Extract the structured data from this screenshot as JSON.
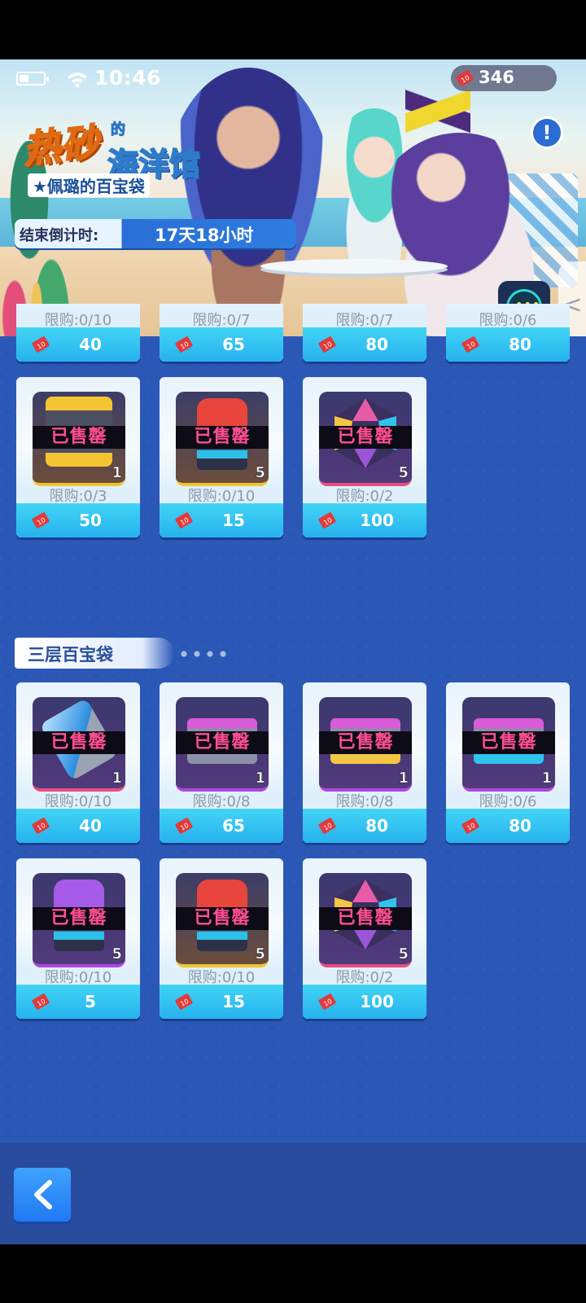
{
  "status_bar": {
    "time": "10:46",
    "currency_amount": "346"
  },
  "banner": {
    "title_main": "热砂",
    "title_de": "的",
    "title_sub": "海洋馆",
    "subtitle": "★佩璐的百宝袋",
    "countdown_label": "结束倒计时:",
    "countdown_value": "17天18小时",
    "info_icon": "exclamation-icon",
    "side_arrow": "<"
  },
  "section_two_partial": [
    {
      "limit": "限购:0/10",
      "price": "40"
    },
    {
      "limit": "限购:0/7",
      "price": "65"
    },
    {
      "limit": "限购:0/7",
      "price": "80"
    },
    {
      "limit": "限购:0/6",
      "price": "80"
    }
  ],
  "section_two_row2": [
    {
      "icon": "vehicle-icon",
      "sold": "已售罄",
      "qty": "1",
      "limit": "限购:0/3",
      "price": "50"
    },
    {
      "icon": "red-capsule-icon",
      "sold": "已售罄",
      "qty": "5",
      "limit": "限购:0/10",
      "price": "15"
    },
    {
      "icon": "gem-icon",
      "sold": "已售罄",
      "qty": "5",
      "limit": "限购:0/2",
      "price": "100"
    }
  ],
  "section_three": {
    "title": "三层百宝袋",
    "items": [
      {
        "icon": "blue-crystal-icon",
        "sold": "已售罄",
        "qty": "1",
        "limit": "限购:0/10",
        "price": "40"
      },
      {
        "icon": "nameplate-icon",
        "sold": "已售罄",
        "qty": "1",
        "limit": "限购:0/8",
        "price": "65"
      },
      {
        "icon": "nameplate-gold-icon",
        "sold": "已售罄",
        "qty": "1",
        "limit": "限购:0/8",
        "price": "80"
      },
      {
        "icon": "nameplate-blue-icon",
        "sold": "已售罄",
        "qty": "1",
        "limit": "限购:0/6",
        "price": "80"
      },
      {
        "icon": "purple-capsule-icon",
        "sold": "已售罄",
        "qty": "5",
        "limit": "限购:0/10",
        "price": "5"
      },
      {
        "icon": "red-capsule-icon",
        "sold": "已售罄",
        "qty": "5",
        "limit": "限购:0/10",
        "price": "15"
      },
      {
        "icon": "gem-icon",
        "sold": "已售罄",
        "qty": "5",
        "limit": "限购:0/2",
        "price": "100"
      }
    ]
  },
  "navigation": {
    "back_icon": "back-arrow-icon"
  }
}
